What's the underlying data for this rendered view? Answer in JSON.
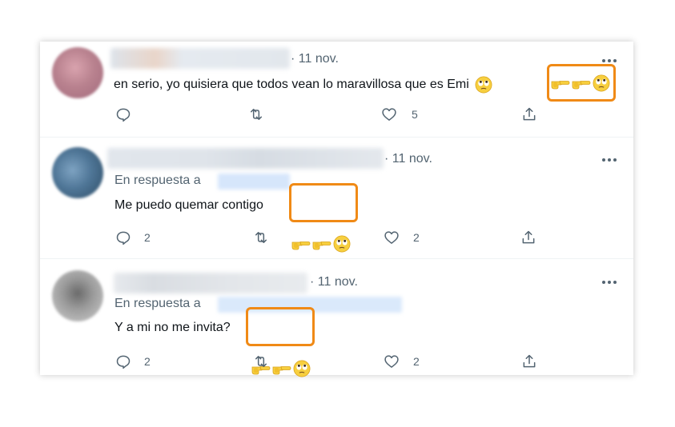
{
  "tweets": [
    {
      "date": "· 11 nov.",
      "text": "en serio, yo quisiera que todos vean lo maravillosa que es Emi",
      "emojis": [
        "face-rolling-eyes",
        "backhand-index-pointing-right",
        "backhand-index-pointing-right",
        "face-rolling-eyes"
      ],
      "actions": {
        "replies": "",
        "retweets": "",
        "likes": "5"
      }
    },
    {
      "date": "· 11 nov.",
      "reply_prefix": "En respuesta a",
      "text": "Me puedo quemar contigo",
      "emojis": [
        "backhand-index-pointing-right",
        "backhand-index-pointing-right",
        "face-rolling-eyes"
      ],
      "actions": {
        "replies": "2",
        "retweets": "",
        "likes": "2"
      }
    },
    {
      "date": "· 11 nov.",
      "reply_prefix": "En respuesta a",
      "text": "Y a mi no me invita?",
      "emojis": [
        "backhand-index-pointing-right",
        "backhand-index-pointing-right",
        "face-rolling-eyes"
      ],
      "actions": {
        "replies": "2",
        "retweets": "",
        "likes": "2"
      }
    }
  ],
  "colors": {
    "highlight": "#f08a16",
    "muted_text": "#536471",
    "primary_text": "#0f1419",
    "divider": "#eff3f4",
    "emoji_yellow": "#f7cf3f"
  }
}
